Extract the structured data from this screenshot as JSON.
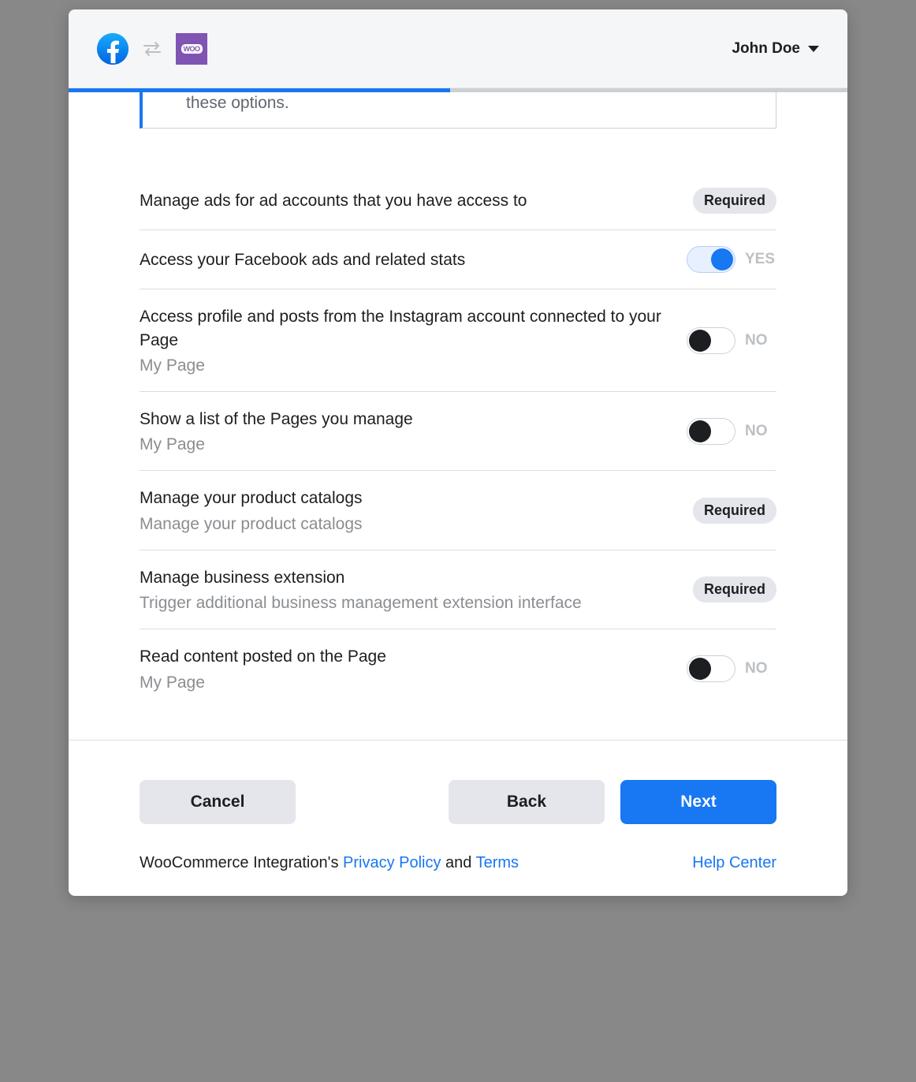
{
  "header": {
    "user_name": "John Doe"
  },
  "info_box": {
    "trailing_text": "these options."
  },
  "labels": {
    "required": "Required",
    "yes": "YES",
    "no": "NO"
  },
  "permissions": [
    {
      "title": "Manage ads for ad accounts that you have access to",
      "sub": "",
      "control": "required"
    },
    {
      "title": "Access your Facebook ads and related stats",
      "sub": "",
      "control": "toggle",
      "on": true
    },
    {
      "title": "Access profile and posts from the Instagram account connected to your Page",
      "sub": "My Page",
      "control": "toggle",
      "on": false
    },
    {
      "title": "Show a list of the Pages you manage",
      "sub": "My Page",
      "control": "toggle",
      "on": false
    },
    {
      "title": "Manage your product catalogs",
      "sub": "Manage your product catalogs",
      "control": "required"
    },
    {
      "title": "Manage business extension",
      "sub": "Trigger additional business management extension interface",
      "control": "required"
    },
    {
      "title": "Read content posted on the Page",
      "sub": "My Page",
      "control": "toggle",
      "on": false
    }
  ],
  "footer": {
    "cancel": "Cancel",
    "back": "Back",
    "next": "Next",
    "integration_prefix": "WooCommerce Integration's ",
    "privacy": "Privacy Policy",
    "and": " and ",
    "terms": "Terms",
    "help": "Help Center"
  }
}
